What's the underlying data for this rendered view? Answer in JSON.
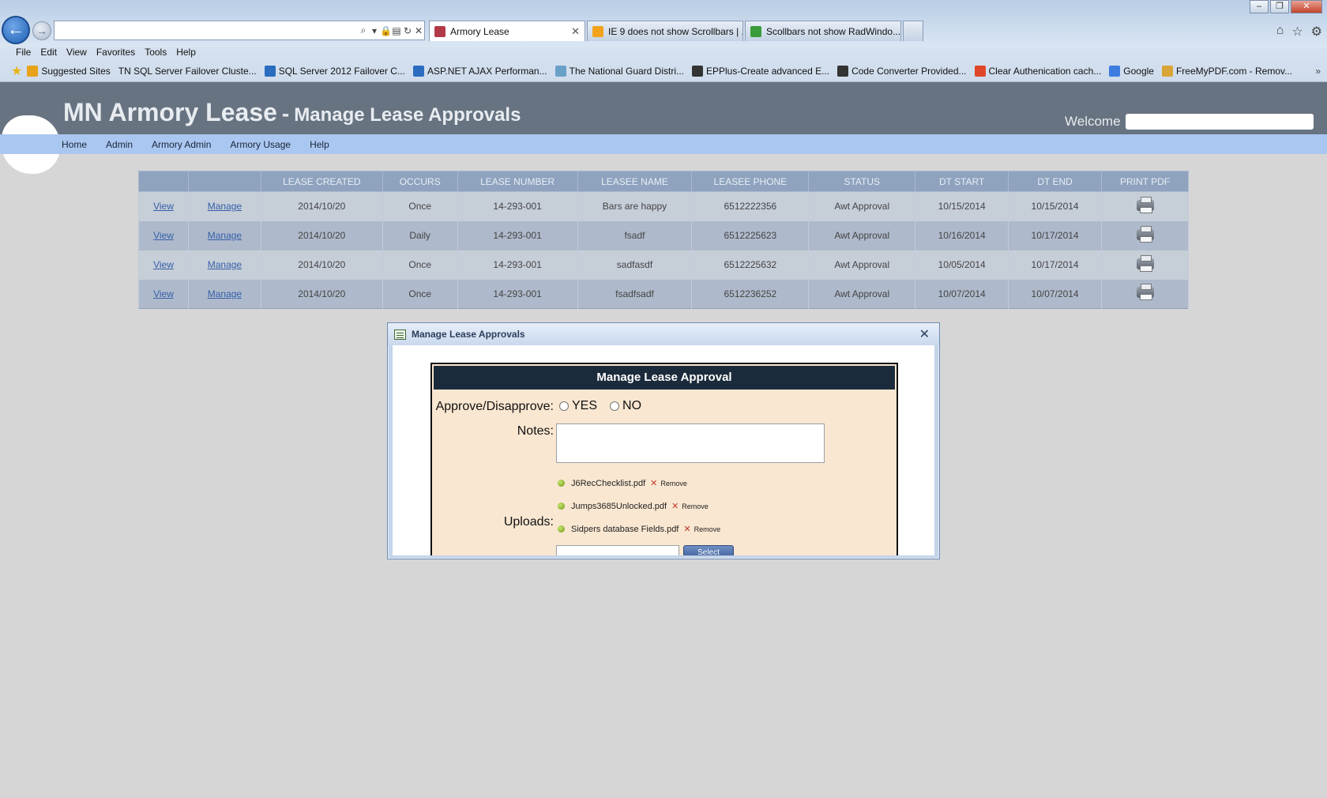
{
  "browser": {
    "tabs": [
      {
        "label": "Armory Lease",
        "icon_color": "#b23a48",
        "active": true
      },
      {
        "label": "IE 9 does not show Scrollbars | ...",
        "icon_color": "#f2a31b",
        "active": false
      },
      {
        "label": "Scollbars not show RadWindo...",
        "icon_color": "#3a9b3a",
        "active": false
      }
    ],
    "menu": [
      "File",
      "Edit",
      "View",
      "Favorites",
      "Tools",
      "Help"
    ],
    "favorites": [
      {
        "label": "Suggested Sites",
        "icon_color": "#e7a31a"
      },
      {
        "label": "TN SQL Server Failover Cluste...",
        "icon_color": ""
      },
      {
        "label": "SQL Server 2012 Failover C...",
        "icon_color": "#2a6cc0"
      },
      {
        "label": "ASP.NET AJAX Performan...",
        "icon_color": "#2a6cc0"
      },
      {
        "label": "The National Guard Distri...",
        "icon_color": "#6aa0c8"
      },
      {
        "label": "EPPlus-Create advanced E...",
        "icon_color": "#333333"
      },
      {
        "label": "Code Converter  Provided...",
        "icon_color": "#333333"
      },
      {
        "label": "Clear Authenication cach...",
        "icon_color": "#e0462a"
      },
      {
        "label": "Google",
        "icon_color": "#3d7de0"
      },
      {
        "label": "FreeMyPDF.com - Remov...",
        "icon_color": "#d8a536"
      }
    ],
    "favorites_more": "»"
  },
  "app": {
    "title": "MN Armory Lease",
    "title_sep": "-",
    "subtitle": "Manage Lease Approvals",
    "welcome": "Welcome"
  },
  "nav": [
    "Home",
    "Admin",
    "Armory Admin",
    "Armory Usage",
    "Help"
  ],
  "grid": {
    "columns": [
      "",
      "",
      "LEASE CREATED",
      "OCCURS",
      "LEASE NUMBER",
      "LEASEE NAME",
      "LEASEE PHONE",
      "STATUS",
      "DT START",
      "DT END",
      "PRINT PDF"
    ],
    "rows": [
      {
        "view": "View",
        "manage": "Manage",
        "created": "2014/10/20",
        "occurs": "Once",
        "number": "14-293-001",
        "name": "Bars are happy",
        "phone": "6512222356",
        "status": "Awt Approval",
        "start": "10/15/2014",
        "end": "10/15/2014"
      },
      {
        "view": "View",
        "manage": "Manage",
        "created": "2014/10/20",
        "occurs": "Daily",
        "number": "14-293-001",
        "name": "fsadf",
        "phone": "6512225623",
        "status": "Awt Approval",
        "start": "10/16/2014",
        "end": "10/17/2014"
      },
      {
        "view": "View",
        "manage": "Manage",
        "created": "2014/10/20",
        "occurs": "Once",
        "number": "14-293-001",
        "name": "sadfasdf",
        "phone": "6512225632",
        "status": "Awt Approval",
        "start": "10/05/2014",
        "end": "10/17/2014"
      },
      {
        "view": "View",
        "manage": "Manage",
        "created": "2014/10/20",
        "occurs": "Once",
        "number": "14-293-001",
        "name": "fsadfsadf",
        "phone": "6512236252",
        "status": "Awt Approval",
        "start": "10/07/2014",
        "end": "10/07/2014"
      }
    ]
  },
  "modal": {
    "title": "Manage Lease Approvals",
    "close": "✕",
    "form_header": "Manage Lease Approval",
    "approve_label": "Approve/Disapprove:",
    "yes_label": "YES",
    "no_label": "NO",
    "notes_label": "Notes:",
    "notes_value": "",
    "uploads_label": "Uploads:",
    "uploads": [
      {
        "file": "J6RecChecklist.pdf",
        "remove": "Remove"
      },
      {
        "file": "Jumps3685Unlocked.pdf",
        "remove": "Remove"
      },
      {
        "file": "Sidpers database Fields.pdf",
        "remove": "Remove"
      }
    ],
    "select_label": "Select"
  }
}
